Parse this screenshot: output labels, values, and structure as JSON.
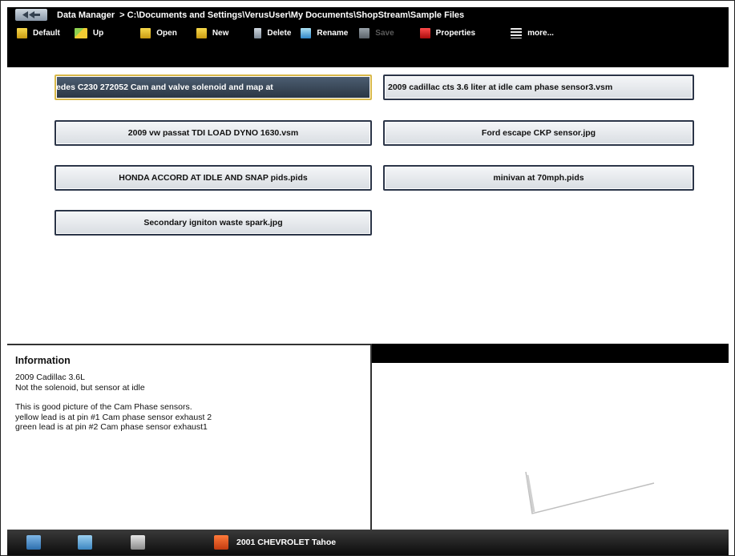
{
  "titlebar": {
    "app_name": "Data Manager",
    "path": "> C:\\Documents and Settings\\VerusUser\\My Documents\\ShopStream\\Sample Files"
  },
  "toolbar": {
    "items": [
      {
        "label": "Default",
        "icon": "folder-home-icon",
        "enabled": true
      },
      {
        "label": "Up",
        "icon": "folder-up-icon",
        "enabled": true
      },
      {
        "label": "Open",
        "icon": "folder-open-icon",
        "enabled": true
      },
      {
        "label": "New",
        "icon": "folder-new-icon",
        "enabled": true
      },
      {
        "label": "Delete",
        "icon": "trash-icon",
        "enabled": true
      },
      {
        "label": "Rename",
        "icon": "rename-icon",
        "enabled": true
      },
      {
        "label": "Save",
        "icon": "save-icon",
        "enabled": false
      },
      {
        "label": "Properties",
        "icon": "properties-icon",
        "enabled": true
      },
      {
        "label": "more...",
        "icon": "more-icon",
        "enabled": true
      }
    ]
  },
  "files": [
    {
      "label": "edes C230  272052 Cam and valve solenoid and map at",
      "selected": true
    },
    {
      "label": "2009 cadillac cts 3.6 liter at idle cam phase sensor3.vsm",
      "selected": false
    },
    {
      "label": "2009 vw passat TDI LOAD DYNO 1630.vsm",
      "selected": false
    },
    {
      "label": "Ford escape CKP sensor.jpg",
      "selected": false
    },
    {
      "label": "HONDA ACCORD AT IDLE AND SNAP pids.pids",
      "selected": false
    },
    {
      "label": "minivan at 70mph.pids",
      "selected": false
    },
    {
      "label": "Secondary igniton waste spark.jpg",
      "selected": false
    }
  ],
  "info": {
    "title": "Information",
    "lines": [
      "2009 Cadillac 3.6L",
      "Not the solenoid, but sensor at idle",
      "This is good picture of the Cam Phase sensors.",
      "yellow lead is at pin #1 Cam phase sensor exhaust 2",
      "green lead is at pin #2 Cam phase sensor exhaust1"
    ]
  },
  "taskbar": {
    "vehicle": "2001 CHEVROLET Tahoe",
    "icons": [
      "home-icon",
      "screen-icon",
      "scope-icon",
      "toolbox-icon"
    ]
  },
  "colors": {
    "toolbar_bg": "#000000",
    "selected_button": "#3b4a5c",
    "selected_border": "#d8b84a",
    "button_border": "#2b3548"
  }
}
